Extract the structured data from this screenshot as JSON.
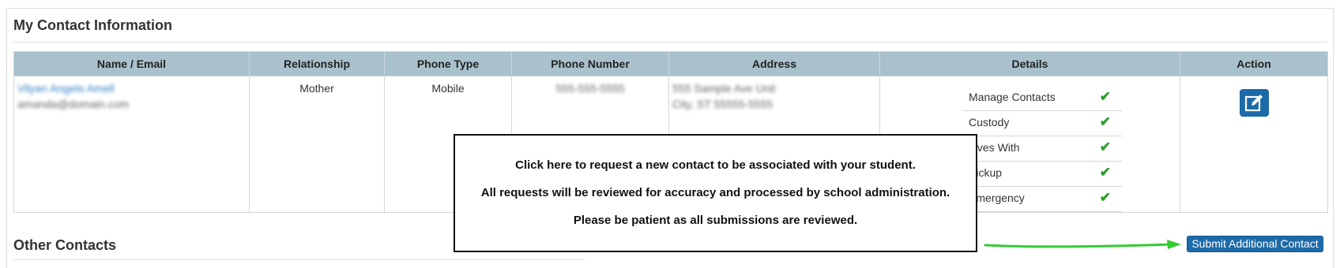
{
  "panel": {
    "title": "My Contact Information"
  },
  "table": {
    "headers": [
      "Name / Email",
      "Relationship",
      "Phone Type",
      "Phone Number",
      "Address",
      "Details",
      "Action"
    ],
    "row": {
      "name": "Vilyan Angelo Amell",
      "email": "amanda@domain.com",
      "relationship": "Mother",
      "phone_type": "Mobile",
      "phone_number": "555-555-5555",
      "address_line1": "555 Sample Ave Unit",
      "address_line2": "City, ST 55555-5555",
      "details": [
        {
          "label": "Manage Contacts",
          "icon": "check-icon"
        },
        {
          "label": "Custody",
          "icon": "check-icon"
        },
        {
          "label": "Lives With",
          "icon": "check-icon"
        },
        {
          "label": "Pickup",
          "icon": "check-icon"
        },
        {
          "label": "Emergency",
          "icon": "check-icon"
        }
      ],
      "action_icon": "edit-icon"
    }
  },
  "other": {
    "title": "Other Contacts"
  },
  "tooltip": {
    "line1": "Click here to request a new contact to be associated with your student.",
    "line2": "All requests will be reviewed for accuracy and processed by school administration.",
    "line3": "Please be patient as all submissions are reviewed."
  },
  "submit_button": {
    "label": "Submit Additional Contact"
  },
  "colors": {
    "header_bg": "#a9c1cd",
    "button_bg": "#1d6aa8",
    "check": "#2e9d2e",
    "arrow": "#33cc33"
  }
}
